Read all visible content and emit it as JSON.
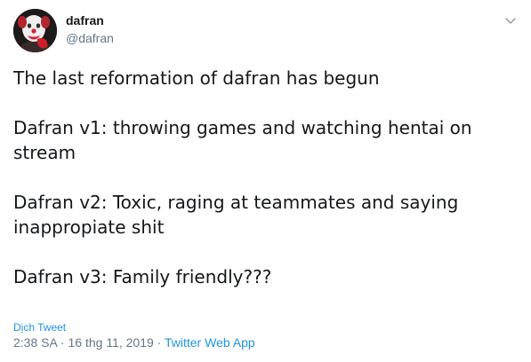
{
  "user": {
    "display_name": "dafran",
    "handle": "@dafran"
  },
  "icons": {
    "menu": "chevron-down-icon",
    "avatar": "clown-avatar"
  },
  "tweet": {
    "paragraphs": [
      "The last reformation of dafran has begun",
      "Dafran v1: throwing games and watching hentai on stream",
      "Dafran v2: Toxic, raging at teammates and saying inappropiate shit",
      "Dafran v3: Family friendly???"
    ]
  },
  "footer": {
    "translate_label": "Dịch Tweet",
    "time": "2:38 SA",
    "separator1": " · ",
    "date": "16 thg 11, 2019",
    "separator2": " · ",
    "source": "Twitter Web App"
  },
  "colors": {
    "text": "#14171a",
    "secondary": "#657786",
    "link": "#1b95e0"
  }
}
